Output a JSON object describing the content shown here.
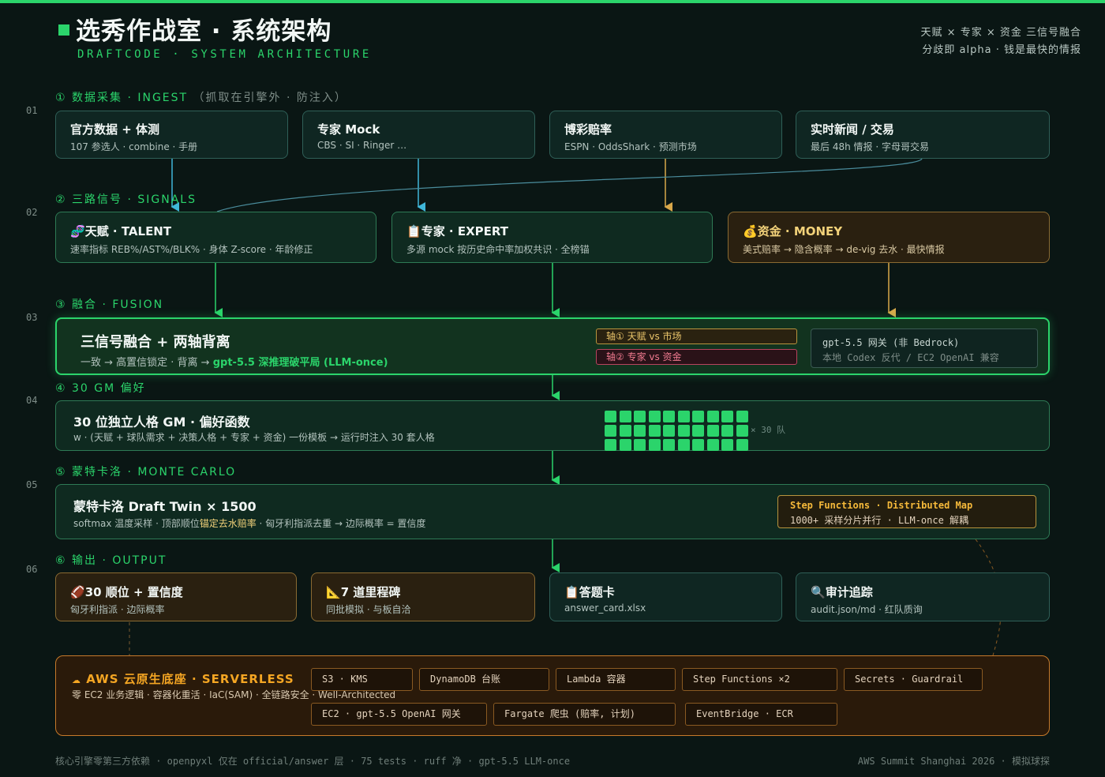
{
  "header": {
    "title": "选秀作战室 · 系统架构",
    "subtitle": "DRAFTCODE · SYSTEM ARCHITECTURE",
    "tagline_1": "天赋 × 专家 × 资金 三信号融合",
    "tagline_2": "分歧即 alpha · 钱是最快的情报"
  },
  "row_numbers": [
    "01",
    "02",
    "03",
    "04",
    "05",
    "06"
  ],
  "sections": {
    "s1": {
      "label": "① 数据采集 · INGEST",
      "note": "（抓取在引擎外 · 防注入）"
    },
    "s2": {
      "label": "② 三路信号 · SIGNALS"
    },
    "s3": {
      "label": "③ 融合 · FUSION"
    },
    "s4": {
      "label": "④ 30 GM 偏好"
    },
    "s5": {
      "label": "⑤ 蒙特卡洛 · MONTE CARLO"
    },
    "s6": {
      "label": "⑥ 输出 · OUTPUT"
    }
  },
  "ingest": [
    {
      "title": "官方数据 + 体测",
      "sub": "107 参选人 · combine · 手册"
    },
    {
      "title": "专家 Mock",
      "sub": "CBS · SI · Ringer …"
    },
    {
      "title": "博彩赔率",
      "sub": "ESPN · OddsShark · 预测市场"
    },
    {
      "title": "实时新闻 / 交易",
      "sub": "最后 48h 情报 · 字母哥交易"
    }
  ],
  "signals": [
    {
      "icon": "🧬",
      "title": "天赋 · TALENT",
      "sub": "速率指标 REB%/AST%/BLK% · 身体 Z-score · 年龄修正"
    },
    {
      "icon": "📋",
      "title": "专家 · EXPERT",
      "sub": "多源 mock 按历史命中率加权共识 · 全榜锚"
    },
    {
      "icon": "💰",
      "title": "资金 · MONEY",
      "sub": "美式赔率 → 隐含概率 → de-vig 去水 · 最快情报"
    }
  ],
  "fusion": {
    "title": "三信号融合 + 两轴背离",
    "sub_a": "一致 → 高置信锁定 · 背离 → ",
    "sub_b": "gpt-5.5 深推理破平局 (LLM-once)",
    "axis1": "轴① 天赋 vs 市场",
    "axis2": "轴② 专家 vs 资金",
    "gw_title": "gpt-5.5 网关 (非 Bedrock)",
    "gw_sub": "本地 Codex 反代 / EC2 OpenAI 兼容"
  },
  "gm": {
    "title": "30 位独立人格 GM · 偏好函数",
    "sub": "w · (天赋 + 球队需求 + 决策人格 + 专家 + 资金) 一份模板 → 运行时注入 30 套人格",
    "teams_label": "× 30 队",
    "team_count": 30
  },
  "mc": {
    "title": "蒙特卡洛 Draft Twin × 1500",
    "sub_a": "softmax 温度采样 · 顶部顺位",
    "sub_b": "锚定去水赔率",
    "sub_c": " · 匈牙利指派去重 → 边际概率 = 置信度",
    "sf_title": "Step Functions · Distributed Map",
    "sf_sub": "1000+ 采样分片并行 · LLM-once 解耦"
  },
  "outputs": [
    {
      "icon": "🏈",
      "title": "30 顺位 + 置信度",
      "sub": "匈牙利指派 · 边际概率"
    },
    {
      "icon": "📐",
      "title": "7 道里程碑",
      "sub": "同批模拟 · 与板自洽"
    },
    {
      "icon": "📋",
      "title": "答题卡",
      "sub": "answer_card.xlsx"
    },
    {
      "icon": "🔍",
      "title": "审计追踪",
      "sub": "audit.json/md · 红队质询"
    }
  ],
  "aws": {
    "title": "AWS 云原生底座 · SERVERLESS",
    "sub": "零 EC2 业务逻辑 · 容器化重活 · IaC(SAM) · 全链路安全 · Well-Architected",
    "chips_row1": [
      "S3 · KMS",
      "DynamoDB 台账",
      "Lambda 容器",
      "Step Functions ×2",
      "Secrets · Guardrail"
    ],
    "chips_row2": [
      "EC2 · gpt-5.5 OpenAI 网关",
      "Fargate 爬虫 (赔率, 计划)",
      "EventBridge · ECR"
    ]
  },
  "footer": {
    "left": "核心引擎零第三方依赖 · openpyxl 仅在 official/answer 层 · 75 tests · ruff 净 · gpt-5.5 LLM-once",
    "right": "AWS Summit Shanghai 2026 · 模拟球探"
  },
  "colors": {
    "accent": "#2bd46b",
    "gold": "#e9c46a",
    "rose": "#f07a8f",
    "aws": "#f5a623"
  }
}
